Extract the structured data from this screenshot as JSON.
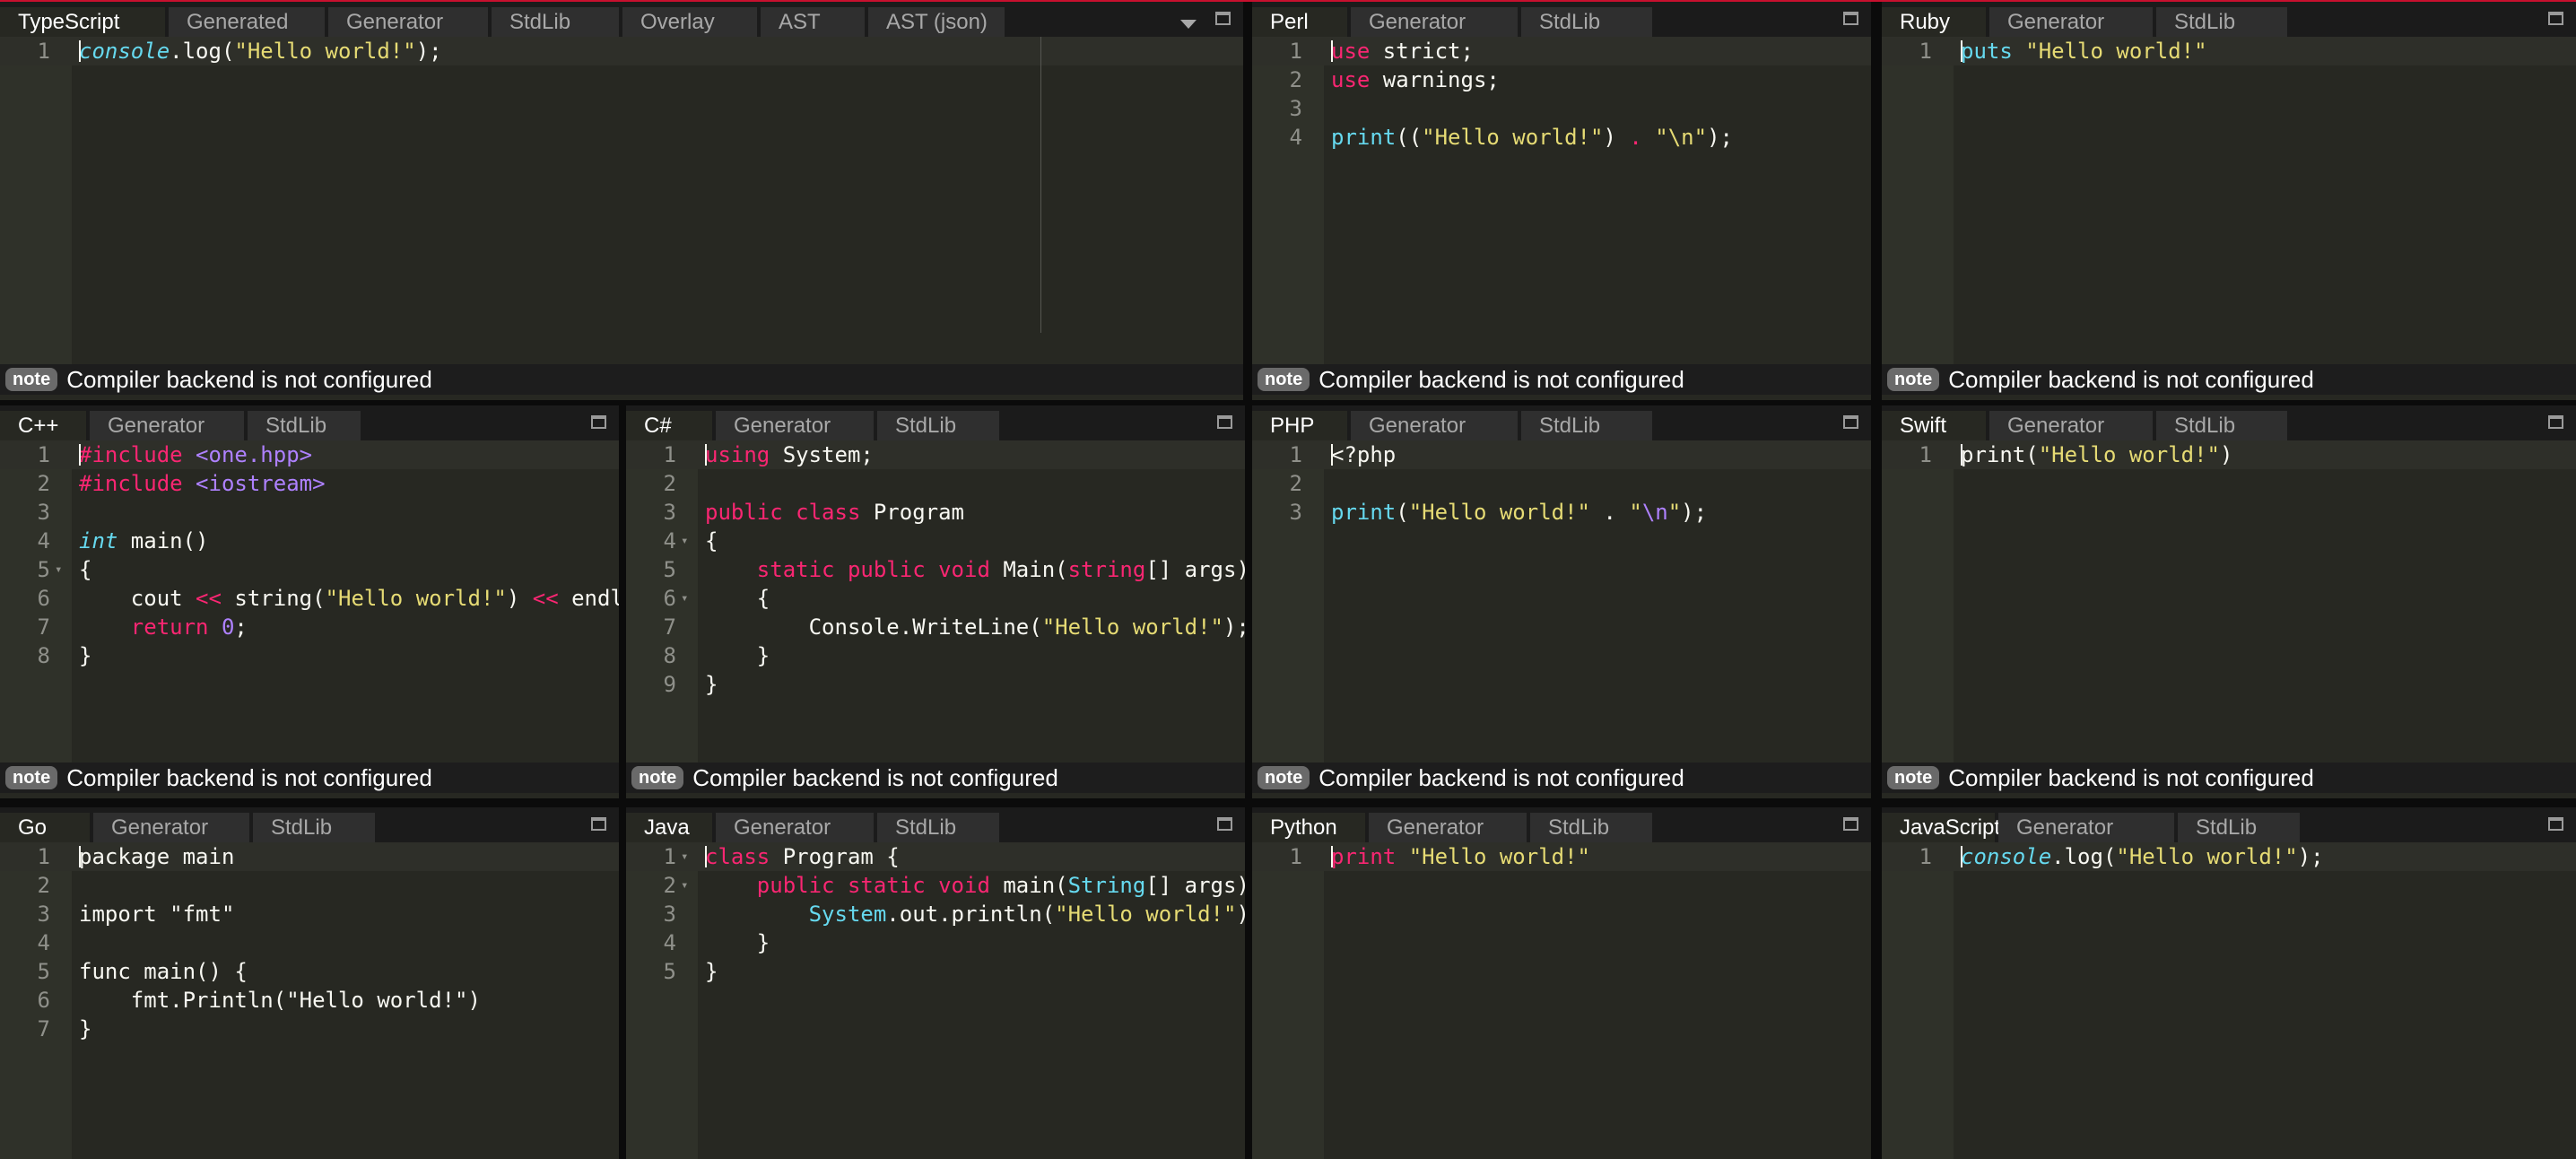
{
  "status_note": "note",
  "panels": [
    {
      "id": "typescript",
      "tabs": [
        "TypeScript",
        "Generated",
        "Generator",
        "StdLib",
        "Overlay",
        "AST",
        "AST (json)"
      ],
      "status": "Compiler backend is not configured",
      "lines": [
        {
          "n": "1",
          "tokens": [
            {
              "t": "console",
              "c": "t-ital"
            },
            {
              "t": ".log(",
              "c": "t-plain"
            },
            {
              "t": "\"Hello world!\"",
              "c": "t-str"
            },
            {
              "t": ");",
              "c": "t-plain"
            }
          ]
        }
      ]
    },
    {
      "id": "perl",
      "tabs": [
        "Perl",
        "Generator",
        "StdLib"
      ],
      "status": "Compiler backend is not configured",
      "lines": [
        {
          "n": "1",
          "tokens": [
            {
              "t": "use",
              "c": "t-kw"
            },
            {
              "t": " strict;",
              "c": "t-plain"
            }
          ]
        },
        {
          "n": "2",
          "tokens": [
            {
              "t": "use",
              "c": "t-kw"
            },
            {
              "t": " warnings;",
              "c": "t-plain"
            }
          ]
        },
        {
          "n": "3",
          "tokens": []
        },
        {
          "n": "4",
          "tokens": [
            {
              "t": "print",
              "c": "t-fn"
            },
            {
              "t": "((",
              "c": "t-plain"
            },
            {
              "t": "\"Hello world!\"",
              "c": "t-str"
            },
            {
              "t": ") ",
              "c": "t-plain"
            },
            {
              "t": ".",
              "c": "t-kw"
            },
            {
              "t": " ",
              "c": "t-plain"
            },
            {
              "t": "\"\\n\"",
              "c": "t-str"
            },
            {
              "t": ");",
              "c": "t-plain"
            }
          ]
        }
      ]
    },
    {
      "id": "ruby",
      "tabs": [
        "Ruby",
        "Generator",
        "StdLib"
      ],
      "status": "Compiler backend is not configured",
      "lines": [
        {
          "n": "1",
          "tokens": [
            {
              "t": "puts",
              "c": "t-fn"
            },
            {
              "t": " ",
              "c": "t-plain"
            },
            {
              "t": "\"Hello world!\"",
              "c": "t-str"
            }
          ]
        }
      ]
    },
    {
      "id": "cpp",
      "tabs": [
        "C++",
        "Generator",
        "StdLib"
      ],
      "status": "Compiler backend is not configured",
      "lines": [
        {
          "n": "1",
          "tokens": [
            {
              "t": "#include",
              "c": "t-kw"
            },
            {
              "t": " ",
              "c": "t-plain"
            },
            {
              "t": "<one.hpp>",
              "c": "t-inc"
            }
          ]
        },
        {
          "n": "2",
          "tokens": [
            {
              "t": "#include",
              "c": "t-kw"
            },
            {
              "t": " ",
              "c": "t-plain"
            },
            {
              "t": "<iostream>",
              "c": "t-inc"
            }
          ]
        },
        {
          "n": "3",
          "tokens": []
        },
        {
          "n": "4",
          "tokens": [
            {
              "t": "int",
              "c": "t-ital"
            },
            {
              "t": " main()",
              "c": "t-plain"
            }
          ]
        },
        {
          "n": "5",
          "fold": true,
          "tokens": [
            {
              "t": "{",
              "c": "t-plain"
            }
          ]
        },
        {
          "n": "6",
          "tokens": [
            {
              "t": "    cout ",
              "c": "t-plain"
            },
            {
              "t": "<<",
              "c": "t-kw"
            },
            {
              "t": " string(",
              "c": "t-plain"
            },
            {
              "t": "\"Hello world!\"",
              "c": "t-str"
            },
            {
              "t": ") ",
              "c": "t-plain"
            },
            {
              "t": "<<",
              "c": "t-kw"
            },
            {
              "t": " endl;",
              "c": "t-plain"
            }
          ]
        },
        {
          "n": "7",
          "tokens": [
            {
              "t": "    ",
              "c": "t-plain"
            },
            {
              "t": "return",
              "c": "t-kw"
            },
            {
              "t": " ",
              "c": "t-plain"
            },
            {
              "t": "0",
              "c": "t-num"
            },
            {
              "t": ";",
              "c": "t-plain"
            }
          ]
        },
        {
          "n": "8",
          "tokens": [
            {
              "t": "}",
              "c": "t-plain"
            }
          ]
        }
      ]
    },
    {
      "id": "csharp",
      "tabs": [
        "C#",
        "Generator",
        "StdLib"
      ],
      "status": "Compiler backend is not configured",
      "lines": [
        {
          "n": "1",
          "tokens": [
            {
              "t": "using",
              "c": "t-kw"
            },
            {
              "t": " System;",
              "c": "t-plain"
            }
          ]
        },
        {
          "n": "2",
          "tokens": []
        },
        {
          "n": "3",
          "tokens": [
            {
              "t": "public",
              "c": "t-kw"
            },
            {
              "t": " ",
              "c": "t-plain"
            },
            {
              "t": "class",
              "c": "t-kw"
            },
            {
              "t": " Program",
              "c": "t-plain"
            }
          ]
        },
        {
          "n": "4",
          "fold": true,
          "tokens": [
            {
              "t": "{",
              "c": "t-plain"
            }
          ]
        },
        {
          "n": "5",
          "tokens": [
            {
              "t": "    ",
              "c": "t-plain"
            },
            {
              "t": "static",
              "c": "t-kw"
            },
            {
              "t": " ",
              "c": "t-plain"
            },
            {
              "t": "public",
              "c": "t-kw"
            },
            {
              "t": " ",
              "c": "t-plain"
            },
            {
              "t": "void",
              "c": "t-kw"
            },
            {
              "t": " Main(",
              "c": "t-plain"
            },
            {
              "t": "string",
              "c": "t-kw"
            },
            {
              "t": "[] args)",
              "c": "t-plain"
            }
          ]
        },
        {
          "n": "6",
          "fold": true,
          "tokens": [
            {
              "t": "    {",
              "c": "t-plain"
            }
          ]
        },
        {
          "n": "7",
          "tokens": [
            {
              "t": "        Console.WriteLine(",
              "c": "t-plain"
            },
            {
              "t": "\"Hello world!\"",
              "c": "t-str"
            },
            {
              "t": ");",
              "c": "t-plain"
            }
          ]
        },
        {
          "n": "8",
          "tokens": [
            {
              "t": "    }",
              "c": "t-plain"
            }
          ]
        },
        {
          "n": "9",
          "tokens": [
            {
              "t": "}",
              "c": "t-plain"
            }
          ]
        }
      ]
    },
    {
      "id": "php",
      "tabs": [
        "PHP",
        "Generator",
        "StdLib"
      ],
      "status": "Compiler backend is not configured",
      "lines": [
        {
          "n": "1",
          "tokens": [
            {
              "t": "<?php",
              "c": "t-plain"
            }
          ]
        },
        {
          "n": "2",
          "tokens": []
        },
        {
          "n": "3",
          "tokens": [
            {
              "t": "print",
              "c": "t-fn"
            },
            {
              "t": "(",
              "c": "t-plain"
            },
            {
              "t": "\"Hello world!\"",
              "c": "t-str"
            },
            {
              "t": " . ",
              "c": "t-plain"
            },
            {
              "t": "\"",
              "c": "t-str"
            },
            {
              "t": "\\n",
              "c": "t-num"
            },
            {
              "t": "\"",
              "c": "t-str"
            },
            {
              "t": ");",
              "c": "t-plain"
            }
          ]
        }
      ]
    },
    {
      "id": "swift",
      "tabs": [
        "Swift",
        "Generator",
        "StdLib"
      ],
      "status": "Compiler backend is not configured",
      "lines": [
        {
          "n": "1",
          "tokens": [
            {
              "t": "print(",
              "c": "t-plain"
            },
            {
              "t": "\"Hello world!\"",
              "c": "t-str"
            },
            {
              "t": ")",
              "c": "t-plain"
            }
          ]
        }
      ]
    },
    {
      "id": "go",
      "tabs": [
        "Go",
        "Generator",
        "StdLib"
      ],
      "status": "",
      "lines": [
        {
          "n": "1",
          "tokens": [
            {
              "t": "package main",
              "c": "t-plain"
            }
          ]
        },
        {
          "n": "2",
          "tokens": []
        },
        {
          "n": "3",
          "tokens": [
            {
              "t": "import \"fmt\"",
              "c": "t-plain"
            }
          ]
        },
        {
          "n": "4",
          "tokens": []
        },
        {
          "n": "5",
          "tokens": [
            {
              "t": "func main() {",
              "c": "t-plain"
            }
          ]
        },
        {
          "n": "6",
          "tokens": [
            {
              "t": "    fmt.Println(\"Hello world!\")",
              "c": "t-plain"
            }
          ]
        },
        {
          "n": "7",
          "tokens": [
            {
              "t": "}",
              "c": "t-plain"
            }
          ]
        }
      ]
    },
    {
      "id": "java",
      "tabs": [
        "Java",
        "Generator",
        "StdLib"
      ],
      "status": "",
      "lines": [
        {
          "n": "1",
          "fold": true,
          "tokens": [
            {
              "t": "class",
              "c": "t-kw"
            },
            {
              "t": " Program {",
              "c": "t-plain"
            }
          ]
        },
        {
          "n": "2",
          "fold": true,
          "tokens": [
            {
              "t": "    ",
              "c": "t-plain"
            },
            {
              "t": "public",
              "c": "t-kw"
            },
            {
              "t": " ",
              "c": "t-plain"
            },
            {
              "t": "static",
              "c": "t-kw"
            },
            {
              "t": " ",
              "c": "t-plain"
            },
            {
              "t": "void",
              "c": "t-kw"
            },
            {
              "t": " main(",
              "c": "t-plain"
            },
            {
              "t": "String",
              "c": "t-fn"
            },
            {
              "t": "[] args)",
              "c": "t-plain"
            }
          ]
        },
        {
          "n": "3",
          "tokens": [
            {
              "t": "        ",
              "c": "t-plain"
            },
            {
              "t": "System",
              "c": "t-fn"
            },
            {
              "t": ".out.println(",
              "c": "t-plain"
            },
            {
              "t": "\"Hello world!\"",
              "c": "t-str"
            },
            {
              "t": ");",
              "c": "t-plain"
            }
          ]
        },
        {
          "n": "4",
          "tokens": [
            {
              "t": "    }",
              "c": "t-plain"
            }
          ]
        },
        {
          "n": "5",
          "tokens": [
            {
              "t": "}",
              "c": "t-plain"
            }
          ]
        }
      ]
    },
    {
      "id": "python",
      "tabs": [
        "Python",
        "Generator",
        "StdLib"
      ],
      "status": "",
      "lines": [
        {
          "n": "1",
          "tokens": [
            {
              "t": "print",
              "c": "t-kw"
            },
            {
              "t": " ",
              "c": "t-plain"
            },
            {
              "t": "\"Hello world!\"",
              "c": "t-str"
            }
          ]
        }
      ]
    },
    {
      "id": "javascript",
      "tabs": [
        "JavaScript",
        "Generator",
        "StdLib"
      ],
      "status": "",
      "lines": [
        {
          "n": "1",
          "tokens": [
            {
              "t": "console",
              "c": "t-ital"
            },
            {
              "t": ".log(",
              "c": "t-plain"
            },
            {
              "t": "\"Hello world!\"",
              "c": "t-str"
            },
            {
              "t": ");",
              "c": "t-plain"
            }
          ]
        }
      ]
    }
  ]
}
